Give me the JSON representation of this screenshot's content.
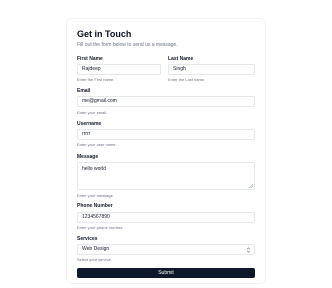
{
  "form": {
    "title": "Get in Touch",
    "subtitle": "Fill out the form below to send us a message.",
    "first_name": {
      "label": "First Name",
      "value": "Rajdeep",
      "help": "Enter the First name."
    },
    "last_name": {
      "label": "Last Name",
      "value": "Singh",
      "help": "Enter the Last name."
    },
    "email": {
      "label": "Email",
      "value": "me@gmail.com",
      "help": "Enter your email."
    },
    "username": {
      "label": "Username",
      "value": "rrrrr",
      "help": "Enter your user name."
    },
    "message": {
      "label": "Message",
      "value": "hello world",
      "help": "Enter your message."
    },
    "phone": {
      "label": "Phone Number",
      "value": "1234567890",
      "help": "Enter your phone number."
    },
    "services": {
      "label": "Services",
      "selected": "Web Design",
      "help": "Select your service."
    },
    "submit_label": "Submit"
  }
}
